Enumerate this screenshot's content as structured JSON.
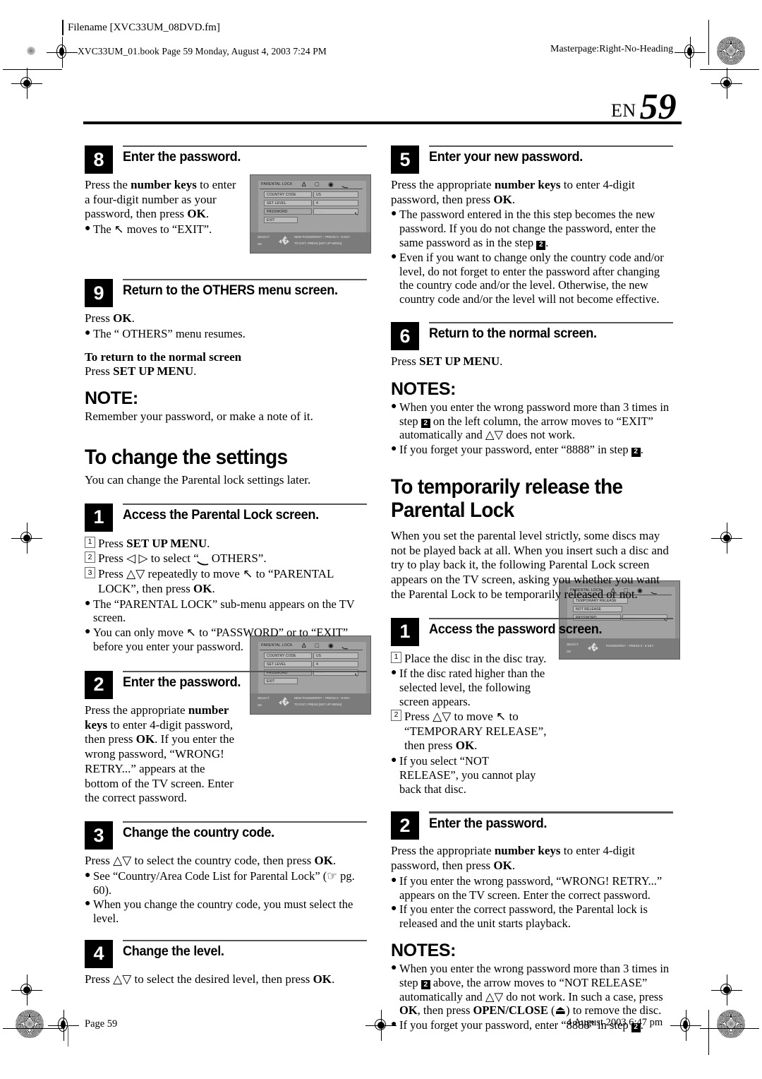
{
  "header": {
    "filename": "Filename [XVC33UM_08DVD.fm]",
    "book_line": "XVC33UM_01.book  Page 59  Monday, August 4, 2003  7:24 PM",
    "masterpage": "Masterpage:Right-No-Heading",
    "page_label": "EN",
    "page_number": "59"
  },
  "footer": {
    "page": "Page 59",
    "date": "4 August 2003 6:47 pm"
  },
  "left_column": {
    "step8": {
      "num": "8",
      "title": "Enter the password.",
      "body_1": "Press the ",
      "body_bold": "number keys",
      "body_2": " to enter a four-digit number as your password, then press ",
      "body_bold2": "OK",
      "body_3": ".",
      "bullet": "The  ↖  moves to “EXIT”."
    },
    "step9": {
      "num": "9",
      "title": "Return to the OTHERS menu screen.",
      "press": "Press ",
      "press_bold": "OK",
      "press_end": ".",
      "bullet": "The “  OTHERS” menu resumes.",
      "subhead": "To return to the normal screen",
      "sub_press": "Press ",
      "sub_press_bold": "SET UP MENU",
      "sub_press_end": ".",
      "note_head": "NOTE:",
      "note_body": "Remember your password, or make a note of it."
    },
    "section": {
      "heading": "To change the settings",
      "intro": "You can change the Parental lock settings later."
    },
    "step1": {
      "num": "1",
      "title": "Access the Parental Lock screen.",
      "items": [
        {
          "n": "1",
          "text_1": "Press ",
          "bold": "SET UP MENU",
          "text_2": "."
        },
        {
          "n": "2",
          "text_1": "Press ◁ ▷ to select “",
          "bold": "",
          "text_2": " OTHERS”."
        },
        {
          "n": "3",
          "text_1": "Press △▽ repeatedly to move ↖ to “PARENTAL LOCK”, then press ",
          "bold": "OK",
          "text_2": "."
        }
      ],
      "bullets": [
        "The “PARENTAL LOCK” sub-menu appears on the TV screen.",
        "You can only move ↖ to “PASSWORD” or to “EXIT” before you enter your password."
      ]
    },
    "step2": {
      "num": "2",
      "title": "Enter the password.",
      "body_1": "Press the appropriate ",
      "body_bold": "number keys",
      "body_2": " to enter 4-digit password, then press ",
      "body_bold2": "OK",
      "body_3": ". If you enter the wrong password, “WRONG! RETRY...” appears at the bottom of the TV screen. Enter the correct password."
    },
    "step3": {
      "num": "3",
      "title": "Change the country code.",
      "body_1": "Press △▽ to select the country code, then press ",
      "body_bold": "OK",
      "body_2": ".",
      "bullets": [
        "See “Country/Area Code List for Parental Lock” (☞ pg. 60).",
        "When you change the country code, you must select the level."
      ]
    },
    "step4": {
      "num": "4",
      "title": "Change the level.",
      "body_1": "Press △▽ to select the desired level, then press ",
      "body_bold": "OK",
      "body_2": "."
    }
  },
  "right_column": {
    "step5": {
      "num": "5",
      "title": "Enter your new password.",
      "body_1": "Press the appropriate ",
      "body_bold": "number keys",
      "body_2": " to enter 4-digit password, then press ",
      "body_bold2": "OK",
      "body_3": ".",
      "bullet1_a": "The password entered in the this step becomes the new password. If you do not change the password, enter the same password as in the step ",
      "bullet1_step": "2",
      "bullet1_b": ".",
      "bullet2": "Even if you want to change only the country code and/or level, do not forget to enter the password after changing the country code and/or the level. Otherwise, the new country code and/or the level will not become effective."
    },
    "step6": {
      "num": "6",
      "title": "Return to the normal screen.",
      "press": "Press ",
      "press_bold": "SET UP MENU",
      "press_end": ".",
      "notes_head": "NOTES:",
      "note1_a": "When you enter the wrong password more than 3 times in step ",
      "note1_step": "2",
      "note1_b": " on the left column, the arrow moves to “EXIT” automatically and △▽ does not work.",
      "note2_a": "If you forget your password, enter “8888” in step ",
      "note2_step": "2",
      "note2_b": "."
    },
    "section": {
      "heading": "To temporarily release the Parental Lock",
      "intro": "When you set the parental level strictly, some discs may not be played back at all. When you insert such a disc and try to play back it, the following Parental Lock screen appears on the TV screen, asking you whether you want the Parental Lock to be temporarily released or not."
    },
    "step1": {
      "num": "1",
      "title": "Access the password screen.",
      "item1_n": "1",
      "item1": "Place the disc in the disc tray.",
      "bullet1": "If the disc rated higher than the selected level, the following screen appears.",
      "item2_n": "2",
      "item2_a": "Press △▽ to move ↖ to “TEMPORARY RELEASE”, then press ",
      "item2_bold": "OK",
      "item2_b": ".",
      "bullet2": "If you select “NOT RELEASE”, you cannot play back that disc."
    },
    "step2": {
      "num": "2",
      "title": "Enter the password.",
      "body_1": "Press the appropriate ",
      "body_bold": "number keys",
      "body_2": " to enter 4-digit password, then press ",
      "body_bold2": "OK",
      "body_3": ".",
      "bullets": [
        "If you enter the wrong password, “WRONG! RETRY...” appears on the TV screen. Enter the correct password.",
        "If you enter the correct password, the Parental lock is released and the unit starts playback."
      ],
      "notes_head": "NOTES:",
      "note1_a": "When you enter the wrong password more than 3 times in step ",
      "note1_step": "2",
      "note1_b": " above, the arrow moves to “NOT RELEASE” automatically and △▽ do not work. In such a case, press ",
      "note1_bold1": "OK",
      "note1_c": ", then press ",
      "note1_bold2": "OPEN/CLOSE",
      "note1_d": " (⏏) to remove the disc.",
      "note2_a": "If you forget your password, enter “8888” in step ",
      "note2_step": "2",
      "note2_b": "."
    }
  },
  "tv_screens": {
    "parental_lock_a": {
      "title": "PARENTAL LOCK",
      "rows": [
        {
          "label": "COUNTRY CODE",
          "value": "US"
        },
        {
          "label": "SET LEVEL",
          "value": "4"
        },
        {
          "label": "PASSWORD",
          "value": "- - - -"
        },
        {
          "label": "EXIT",
          "value": ""
        }
      ],
      "footer_left_1": "SELECT",
      "footer_left_2": "OK",
      "footer_right_1": "NEW PASSWORD?  – PRESS 0 - 9 KEY",
      "footer_right_2": "TO EXIT, PRESS [SET UP MENU]"
    },
    "parental_lock_b": {
      "title": "PARENTAL LOCK",
      "rows": [
        {
          "label": "TEMPORARY RELEASE",
          "value": ""
        },
        {
          "label": "NOT RELEASE",
          "value": ""
        },
        {
          "label": "PASSWORD",
          "value": "- - - -"
        }
      ],
      "footer_left_1": "SELECT",
      "footer_left_2": "OK",
      "footer_right_1": "PASSWORD?  – PRESS 0 - 9 KEY",
      "footer_right_2": ""
    }
  }
}
